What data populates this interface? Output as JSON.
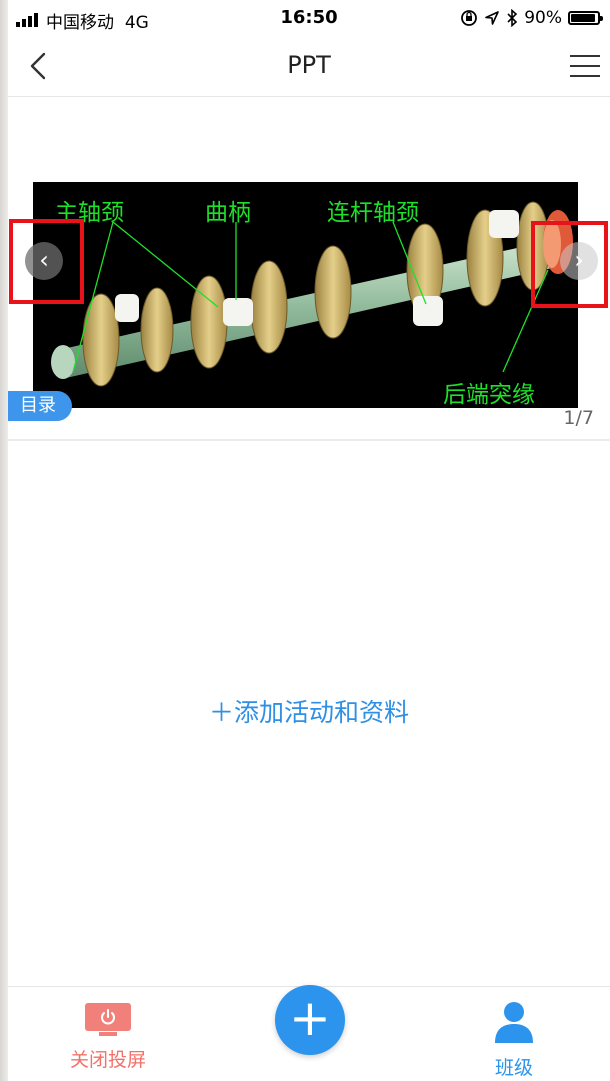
{
  "status_bar": {
    "carrier": "中国移动",
    "network": "4G",
    "time": "16:50",
    "battery": "90%"
  },
  "nav": {
    "title": "PPT",
    "back_icon": "chevron-left-icon",
    "menu_icon": "hamburger-menu-icon"
  },
  "slide": {
    "labels": {
      "main_journal": "主轴颈",
      "crank": "曲柄",
      "rod_journal": "连杆轴颈",
      "rear_flange": "后端突缘"
    },
    "toc_label": "目录",
    "page_indicator": "1/7",
    "prev_icon": "chevron-left-icon",
    "next_icon": "chevron-right-icon"
  },
  "main": {
    "add_link": "＋添加活动和资料"
  },
  "tabbar": {
    "close_cast_label": "关闭投屏",
    "class_label": "班级",
    "colors": {
      "accent": "#2c94ec",
      "close": "#f2716a"
    }
  }
}
